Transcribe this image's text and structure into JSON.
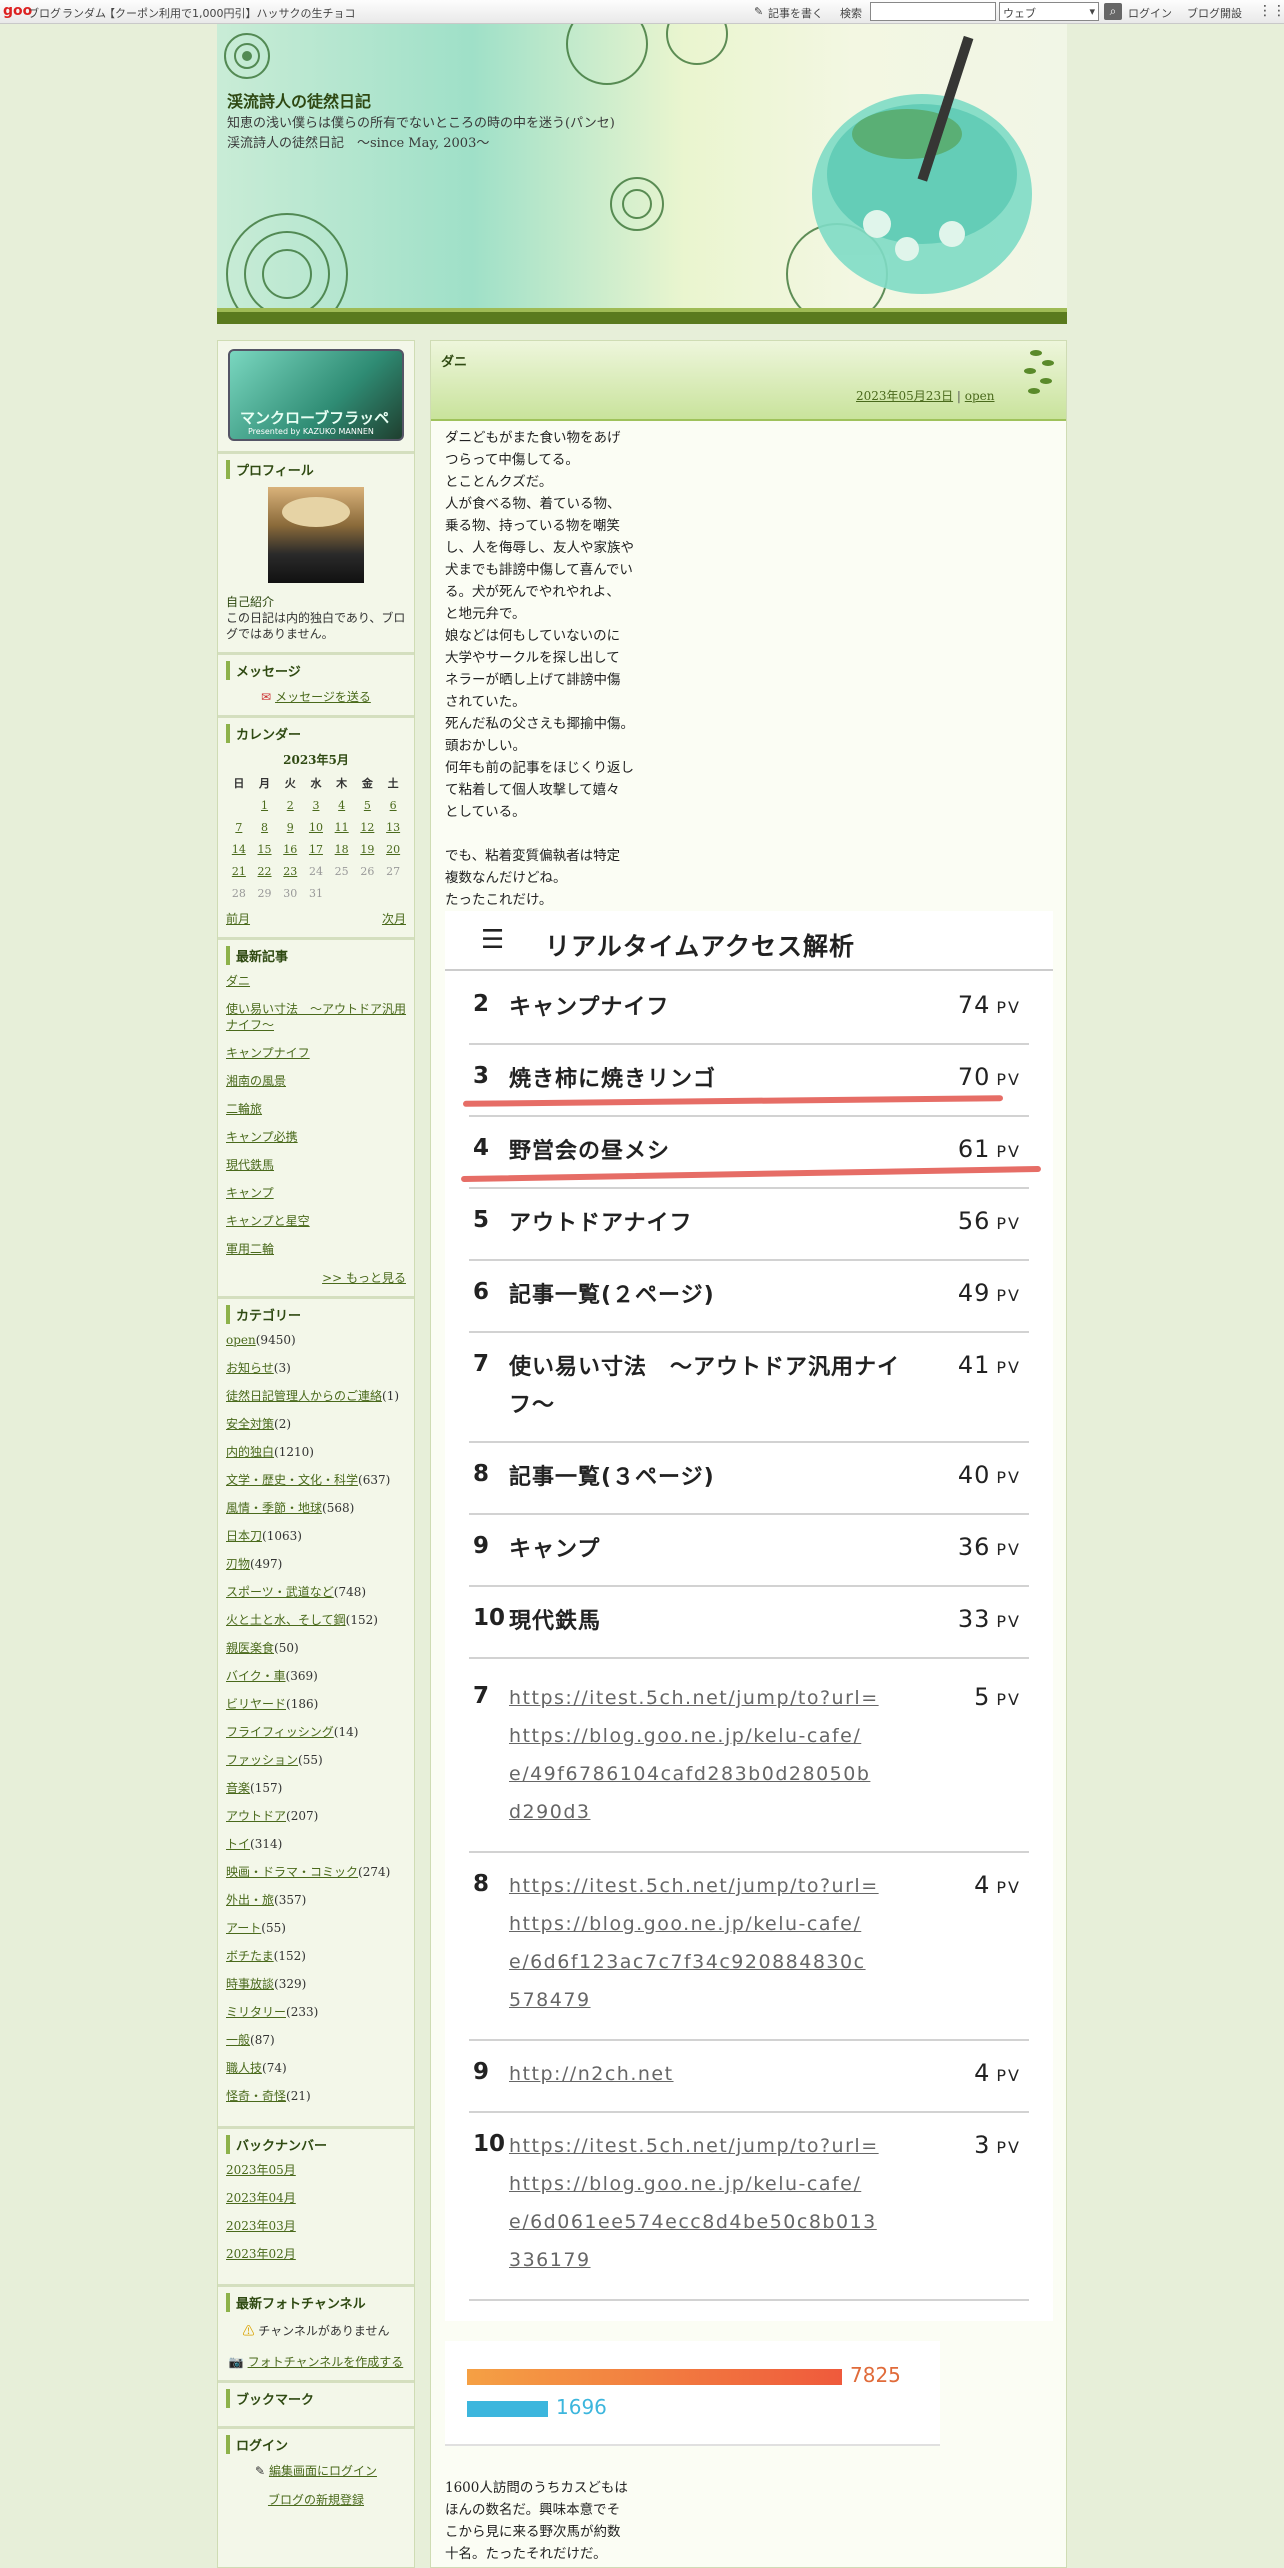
{
  "topbar": {
    "logo": "goo",
    "links": [
      "ブログ",
      "ランダム",
      "【クーポン利用で1,000円引】ハッサクの生チョコ"
    ],
    "write": "記事を書く",
    "search_label": "検索",
    "search_placeholder": "",
    "search_scope": "ウェブ",
    "login": "ログイン",
    "open_blog": "ブログ開設"
  },
  "header": {
    "title": "渓流詩人の徒然日記",
    "description": "知恵の浅い僕らは僕らの所有でないところの時の中を迷う(パンセ)　渓流詩人の徒然日記　～since May, 2003～"
  },
  "sidebar": {
    "banner_title": "マンクローブフラッペ",
    "banner_sub": "Presented by KAZUKO MANNEN",
    "profile_heading": "プロフィール",
    "self_intro_label": "自己紹介",
    "self_intro_text": "この日記は内的独白であり、ブログではありません。",
    "message_heading": "メッセージ",
    "message_link": "メッセージを送る",
    "calendar_heading": "カレンダー",
    "calendar_caption": "2023年5月",
    "calendar_days": [
      "日",
      "月",
      "火",
      "水",
      "木",
      "金",
      "土"
    ],
    "calendar_rows": [
      [
        "",
        "1",
        "2",
        "3",
        "4",
        "5",
        "6"
      ],
      [
        "7",
        "8",
        "9",
        "10",
        "11",
        "12",
        "13"
      ],
      [
        "14",
        "15",
        "16",
        "17",
        "18",
        "19",
        "20"
      ],
      [
        "21",
        "22",
        "23",
        "24",
        "25",
        "26",
        "27"
      ],
      [
        "28",
        "29",
        "30",
        "31",
        "",
        "",
        ""
      ]
    ],
    "calendar_prev": "前月",
    "calendar_next": "次月",
    "recent_heading": "最新記事",
    "recent_items": [
      "ダニ",
      "使い易い寸法　～アウトドア汎用ナイフ～",
      "キャンプナイフ",
      "湘南の風景",
      "二輪旅",
      "キャンプ必携",
      "現代鉄馬",
      "キャンプ",
      "キャンプと星空",
      "軍用二輪"
    ],
    "recent_more": ">> もっと見る",
    "category_heading": "カテゴリー",
    "categories": [
      {
        "name": "open",
        "count": "(9450)"
      },
      {
        "name": "お知らせ",
        "count": "(3)"
      },
      {
        "name": "徒然日記管理人からのご連絡",
        "count": "(1)"
      },
      {
        "name": "安全対策",
        "count": "(2)"
      },
      {
        "name": "内的独白",
        "count": "(1210)"
      },
      {
        "name": "文学・歴史・文化・科学",
        "count": "(637)"
      },
      {
        "name": "風情・季節・地球",
        "count": "(568)"
      },
      {
        "name": "日本刀",
        "count": "(1063)"
      },
      {
        "name": "刃物",
        "count": "(497)"
      },
      {
        "name": "スポーツ・武道など",
        "count": "(748)"
      },
      {
        "name": "火と土と水、そして鋼",
        "count": "(152)"
      },
      {
        "name": "親医楽食",
        "count": "(50)"
      },
      {
        "name": "バイク・車",
        "count": "(369)"
      },
      {
        "name": "ビリヤード",
        "count": "(186)"
      },
      {
        "name": "フライフィッシング",
        "count": "(14)"
      },
      {
        "name": "ファッション",
        "count": "(55)"
      },
      {
        "name": "音楽",
        "count": "(157)"
      },
      {
        "name": "アウトドア",
        "count": "(207)"
      },
      {
        "name": "トイ",
        "count": "(314)"
      },
      {
        "name": "映画・ドラマ・コミック",
        "count": "(274)"
      },
      {
        "name": "外出・旅",
        "count": "(357)"
      },
      {
        "name": "アート",
        "count": "(55)"
      },
      {
        "name": "ボチたま",
        "count": "(152)"
      },
      {
        "name": "時事放談",
        "count": "(329)"
      },
      {
        "name": "ミリタリー",
        "count": "(233)"
      },
      {
        "name": "一般",
        "count": "(87)"
      },
      {
        "name": "職人技",
        "count": "(74)"
      },
      {
        "name": "怪奇・奇怪",
        "count": "(21)"
      }
    ],
    "backnumber_heading": "バックナンバー",
    "backnumbers": [
      "2023年05月",
      "2023年04月",
      "2023年03月",
      "2023年02月"
    ],
    "photo_heading": "最新フォトチャンネル",
    "photo_none": "チャンネルがありません",
    "photo_create": "フォトチャンネルを作成する",
    "bookmark_heading": "ブックマーク",
    "login_heading": "ログイン",
    "login_edit": "編集画面にログイン",
    "login_register": "ブログの新規登録"
  },
  "post": {
    "title": "ダニ",
    "date": "2023年05月23日",
    "category": "open",
    "body": "ダニどもがまた食い物をあげ\nつらって中傷してる。\nとことんクズだ。\n人が食べる物、着ている物、\n乗る物、持っている物を嘲笑\nし、人を侮辱し、友人や家族や\n犬までも誹謗中傷して喜んでい\nる。犬が死んでやれやれよ、\nと地元弁で。\n娘などは何もしていないのに\n大学やサークルを探し出して\nネラーが晒し上げて誹謗中傷\nされていた。\n死んだ私の父さえも揶揄中傷。\n頭おかしい。\n何年も前の記事をほじくり返し\nて粘着して個人攻撃して嬉々\nとしている。\n\nでも、粘着変質偏執者は特定\n複数なんだけどね。\nたったこれだけ。",
    "footer": "1600人訪問のうちカスどもは\nほんの数名だ。興味本意でそ\nこから見に来る野次馬が約数\n十名。たったそれだけだ。"
  },
  "analytics": {
    "title": "リアルタイムアクセス解析",
    "pv_unit": "PV",
    "articles": [
      {
        "rank": "2",
        "title": "キャンプナイフ",
        "pv": "74"
      },
      {
        "rank": "3",
        "title": "焼き柿に焼きリンゴ",
        "pv": "70"
      },
      {
        "rank": "4",
        "title": "野営会の昼メシ",
        "pv": "61"
      },
      {
        "rank": "5",
        "title": "アウトドアナイフ",
        "pv": "56"
      },
      {
        "rank": "6",
        "title": "記事一覧(２ページ)",
        "pv": "49"
      },
      {
        "rank": "7",
        "title": "使い易い寸法　～アウトドア汎用ナイフ～",
        "pv": "41"
      },
      {
        "rank": "8",
        "title": "記事一覧(３ページ)",
        "pv": "40"
      },
      {
        "rank": "9",
        "title": "キャンプ",
        "pv": "36"
      },
      {
        "rank": "10",
        "title": "現代鉄馬",
        "pv": "33"
      }
    ],
    "referrers": [
      {
        "rank": "7",
        "url": "https://itest.5ch.net/jump/to?url=https://blog.goo.ne.jp/kelu-cafe/e/49f6786104cafd283b0d28050bd290d3",
        "pv": "5"
      },
      {
        "rank": "8",
        "url": "https://itest.5ch.net/jump/to?url=https://blog.goo.ne.jp/kelu-cafe/e/6d6f123ac7c7f34c920884830c578479",
        "pv": "4"
      },
      {
        "rank": "9",
        "url": "http://n2ch.net",
        "pv": "4"
      },
      {
        "rank": "10",
        "url": "https://itest.5ch.net/jump/to?url=https://blog.goo.ne.jp/kelu-cafe/e/6d061ee574ecc8d4be50c8b013336179",
        "pv": "3"
      }
    ],
    "bar_pv": 7825,
    "bar_uu": 1696,
    "bar_pv_label": "7825",
    "bar_uu_label": "1696",
    "colors": {
      "pv_bar": "#ef5a3c",
      "uu_bar": "#3cb6dd",
      "underline": "#e2544b"
    }
  }
}
